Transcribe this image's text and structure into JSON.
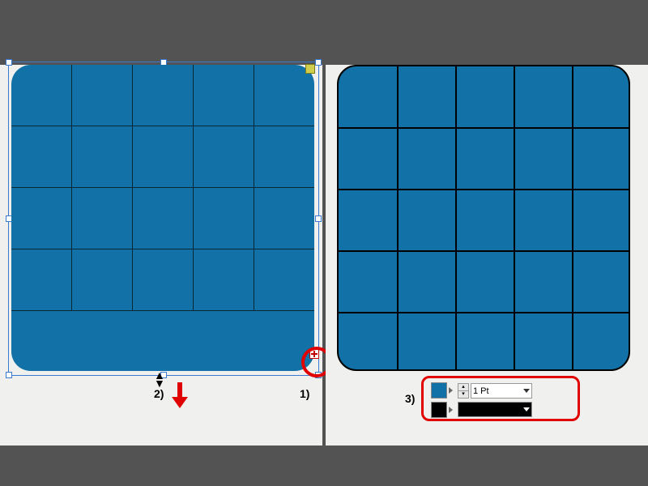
{
  "annotations": {
    "step1_label": "1)",
    "step2_label": "2)",
    "step3_label": "3)"
  },
  "controls": {
    "stroke_weight": "1 Pt",
    "fill_color": "#1272a7",
    "stroke_color": "#000000"
  },
  "grid": {
    "rows": 5,
    "cols": 5
  }
}
